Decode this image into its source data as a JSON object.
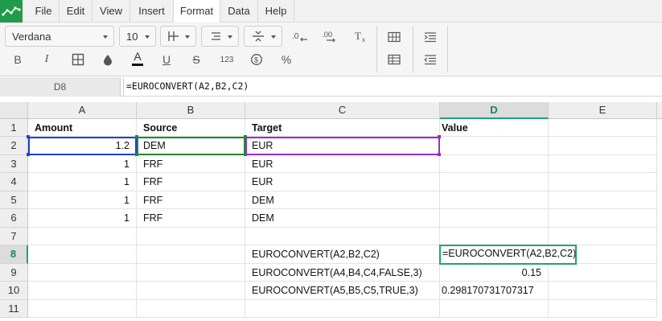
{
  "menu": {
    "items": [
      {
        "label": "File"
      },
      {
        "label": "Edit"
      },
      {
        "label": "View"
      },
      {
        "label": "Insert"
      },
      {
        "label": "Format"
      },
      {
        "label": "Data"
      },
      {
        "label": "Help"
      }
    ],
    "active": "Format"
  },
  "toolbar": {
    "font_name": "Verdana",
    "font_size": "10",
    "icons": {
      "decrease_decimals": "decrease-decimals-icon",
      "increase_decimals": "increase-decimals-icon",
      "clear_format": "clear-format-icon",
      "bold": "B",
      "italic": "I",
      "borders": "borders-icon",
      "fill": "fill-color-icon",
      "font_color": "A",
      "underline": "U",
      "strike": "S",
      "number_format": "123",
      "currency": "$",
      "percent": "%"
    }
  },
  "formula_bar": {
    "cell_ref": "D8",
    "formula": "=EUROCONVERT(A2,B2,C2)"
  },
  "sheet": {
    "columns": [
      "A",
      "B",
      "C",
      "D",
      "E"
    ],
    "selected_column": "D",
    "rows": [
      "1",
      "2",
      "3",
      "4",
      "5",
      "6",
      "7",
      "8",
      "9",
      "10",
      "11"
    ],
    "selected_row": "8",
    "cells": {
      "A1": "Amount",
      "B1": "Source",
      "C1": "Target",
      "D1": "Value",
      "A2": "1.2",
      "B2": "DEM",
      "C2": "EUR",
      "A3": "1",
      "B3": "FRF",
      "C3": "EUR",
      "A4": "1",
      "B4": "FRF",
      "C4": "EUR",
      "A5": "1",
      "B5": "FRF",
      "C5": "DEM",
      "A6": "1",
      "B6": "FRF",
      "C6": "DEM",
      "C8": "EUROCONVERT(A2,B2,C2)",
      "C9": "EUROCONVERT(A4,B4,C4,FALSE,3)",
      "D9": "0.15",
      "C10": "EUROCONVERT(A5,B5,C5,TRUE,3)",
      "D10": "0.298170731707317"
    },
    "active_cell_content": "=EUROCONVERT(A2,B2,C2)"
  },
  "colors": {
    "accent": "#1aa57a",
    "ref_a": "#1f3fd6",
    "ref_b": "#1d8a2e",
    "ref_c": "#9b2bc7",
    "logo": "#1f9b4a"
  }
}
